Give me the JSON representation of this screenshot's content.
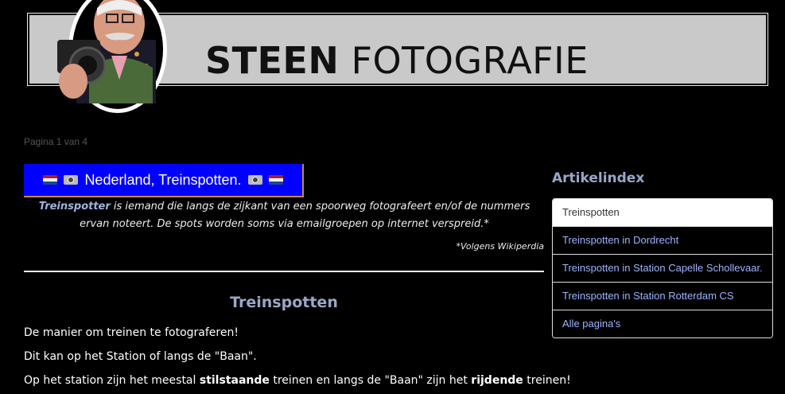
{
  "header": {
    "brand_bold": "STEEN",
    "brand_regular": " FOTOGRAFIE",
    "photo_icon": "photographer-portrait"
  },
  "pagination": "Pagina 1 van 4",
  "title_bar": {
    "text": "Nederland, Treinspotten.",
    "background": "#0000ff",
    "border": "#c9893a",
    "icons": [
      "netherlands-flag-icon",
      "camera-icon"
    ]
  },
  "intro": {
    "keyword": "Treinspotter",
    "text": " is iemand die langs de zijkant van een spoorweg fotografeert en/of de nummers ervan noteert. De spots worden soms via emailgroepen op internet verspreid.*",
    "source": "*Volgens Wikiperdia"
  },
  "article": {
    "heading": "Treinspotten",
    "p1": "De manier om treinen te fotograferen!",
    "p2": "Dit kan op het Station of langs de \"Baan\".",
    "p3_a": "Op het station zijn het meestal ",
    "p3_b": "stilstaande",
    "p3_c": " treinen en langs de \"Baan\" zijn het ",
    "p3_d": "rijdende",
    "p3_e": " treinen!"
  },
  "sidebar": {
    "title": "Artikelindex",
    "items": [
      {
        "label": "Treinspotten"
      },
      {
        "label": "Treinspotten in Dordrecht"
      },
      {
        "label": "Treinspotten in Station Capelle Schollevaar."
      },
      {
        "label": "Treinspotten in Station Rotterdam CS"
      },
      {
        "label": "Alle pagina's"
      }
    ]
  },
  "colors": {
    "accent_heading": "#9aa7c8",
    "link": "#9db3ff"
  }
}
